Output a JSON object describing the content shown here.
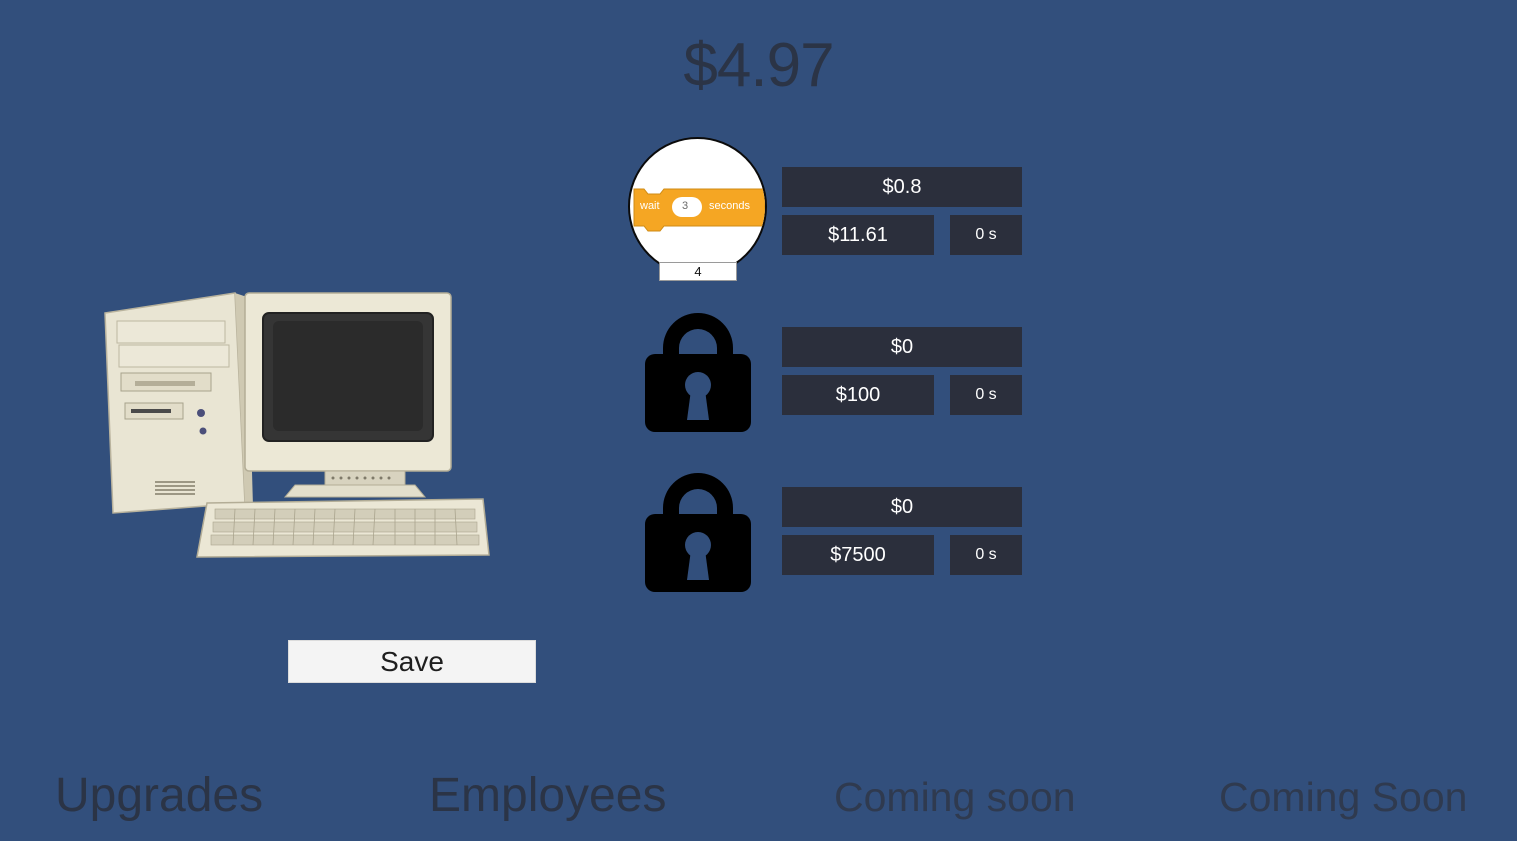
{
  "money": "$4.97",
  "save_label": "Save",
  "items": [
    {
      "icon": "scratch-wait-block-icon",
      "block": {
        "word1": "wait",
        "num": "3",
        "word2": "seconds"
      },
      "count": "4",
      "rate": "$0.8",
      "cost": "$11.61",
      "time": "0 s"
    },
    {
      "icon": "lock-icon",
      "rate": "$0",
      "cost": "$100",
      "time": "0 s"
    },
    {
      "icon": "lock-icon",
      "rate": "$0",
      "cost": "$7500",
      "time": "0 s"
    }
  ],
  "nav": {
    "upgrades": "Upgrades",
    "employees": "Employees",
    "coming_soon_1": "Coming soon",
    "coming_soon_2": "Coming Soon"
  },
  "colors": {
    "background": "#324f7c",
    "panel": "#2b2f3c",
    "scratch_orange": "#f5a623"
  }
}
